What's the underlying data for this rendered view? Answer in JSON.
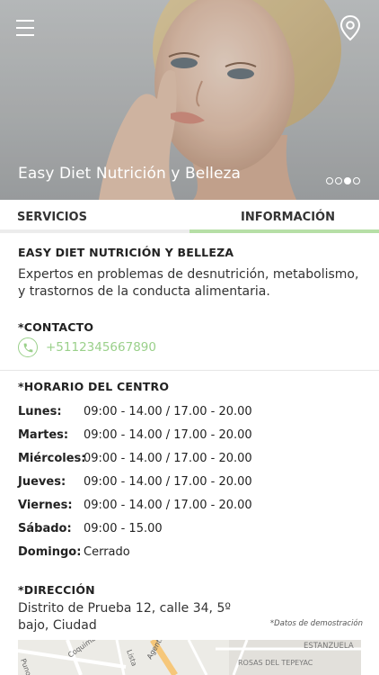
{
  "hero": {
    "title": "Easy Diet Nutrición y Belleza",
    "slides": 4,
    "active_slide": 3
  },
  "icons": {
    "menu": "hamburger-icon",
    "location": "location-pin-icon",
    "phone": "phone-icon"
  },
  "tabs": [
    {
      "label": "SERVICIOS",
      "active": false
    },
    {
      "label": "INFORMACIÓN",
      "active": true
    }
  ],
  "business": {
    "name": "EASY DIET NUTRICIÓN Y BELLEZA",
    "description": "Expertos en problemas de desnutrición, metabolismo, y trastornos de la conducta alimentaria."
  },
  "contact": {
    "heading": "*CONTACTO",
    "phone": "+5112345667890"
  },
  "hours": {
    "heading": "*HORARIO DEL CENTRO",
    "rows": [
      {
        "day": "Lunes:",
        "time": "09:00 - 14.00  /  17.00 - 20.00"
      },
      {
        "day": "Martes:",
        "time": "09:00 - 14.00  /  17.00 - 20.00"
      },
      {
        "day": "Miércoles:",
        "time": "09:00 - 14.00  /  17.00 - 20.00"
      },
      {
        "day": "Jueves:",
        "time": "09:00 - 14.00  /  17.00 - 20.00"
      },
      {
        "day": "Viernes:",
        "time": "09:00 - 14.00  /  17.00 - 20.00"
      },
      {
        "day": "Sábado:",
        "time": "09:00 - 15.00"
      },
      {
        "day": "Domingo:",
        "time": "Cerrado"
      }
    ]
  },
  "address": {
    "heading": "*DIRECCIÓN",
    "text": "Distrito de Prueba 12, calle 34, 5º bajo, Ciudad",
    "demo_note": "*Datos de demostración"
  },
  "map": {
    "labels": [
      "Puno",
      "Coquimbo",
      "Lista",
      "Agentes Nu",
      "ESTANZUELA",
      "ROSAS DEL TEPEYAC"
    ]
  },
  "colors": {
    "accent": "#9ad08a",
    "tab_active_bar": "#b6dfa6",
    "tab_inactive_bar": "#ececec"
  }
}
